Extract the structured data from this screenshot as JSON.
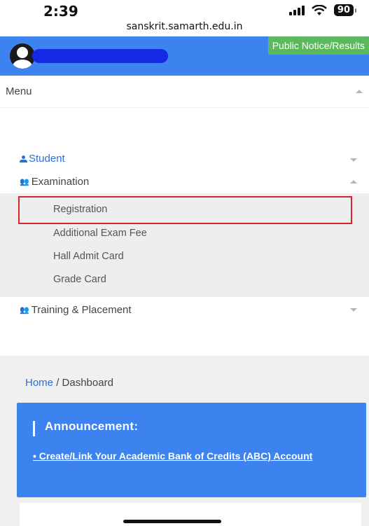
{
  "status_bar": {
    "time": "2:39",
    "battery": "90"
  },
  "browser": {
    "url": "sanskrit.samarth.edu.in"
  },
  "header": {
    "public_notice_label": "Public Notice/Results",
    "accent_color": "#3c83f0",
    "notice_color": "#5cb85c"
  },
  "menu": {
    "label": "Menu",
    "items": [
      {
        "label": "Student",
        "icon": "person-icon"
      },
      {
        "label": "Examination",
        "icon": "group-icon",
        "children": [
          {
            "label": "Registration"
          },
          {
            "label": "Additional Exam Fee"
          },
          {
            "label": "Hall Admit Card"
          },
          {
            "label": "Grade Card"
          }
        ]
      },
      {
        "label": "Training & Placement",
        "icon": "group-icon"
      }
    ]
  },
  "breadcrumb": {
    "home": "Home",
    "separator": "/",
    "current": "Dashboard"
  },
  "announcement": {
    "title": "Announcement:",
    "link": "• Create/Link Your Academic Bank of Credits (ABC) Account"
  },
  "highlight_color": "#d9262c"
}
